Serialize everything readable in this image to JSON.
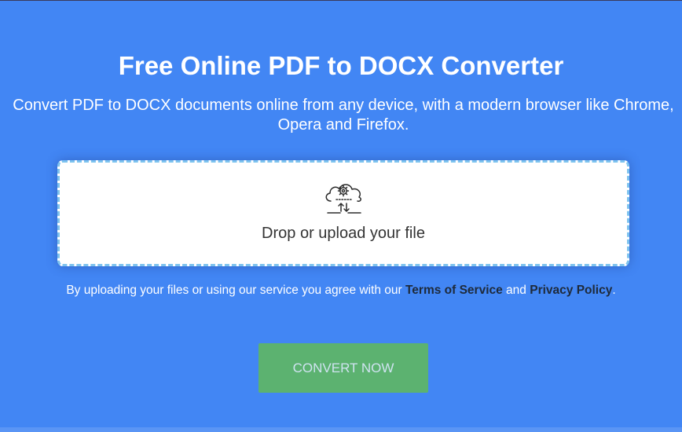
{
  "header": {
    "title": "Free Online PDF to DOCX Converter",
    "subtitle": "Convert PDF to DOCX documents online from any device, with a modern browser like Chrome, Opera and Firefox."
  },
  "dropzone": {
    "icon": "cloud-gear-upload-icon",
    "label": "Drop or upload your file"
  },
  "notice": {
    "prefix": "By uploading your files or using our service you agree with our ",
    "terms_link": "Terms of Service",
    "middle": " and ",
    "privacy_link": "Privacy Policy",
    "suffix": "."
  },
  "convert_button": {
    "label": "CONVERT NOW"
  },
  "colors": {
    "background": "#4286f4",
    "button": "#5cb270",
    "dropzone_border": "#7ec3ef"
  }
}
